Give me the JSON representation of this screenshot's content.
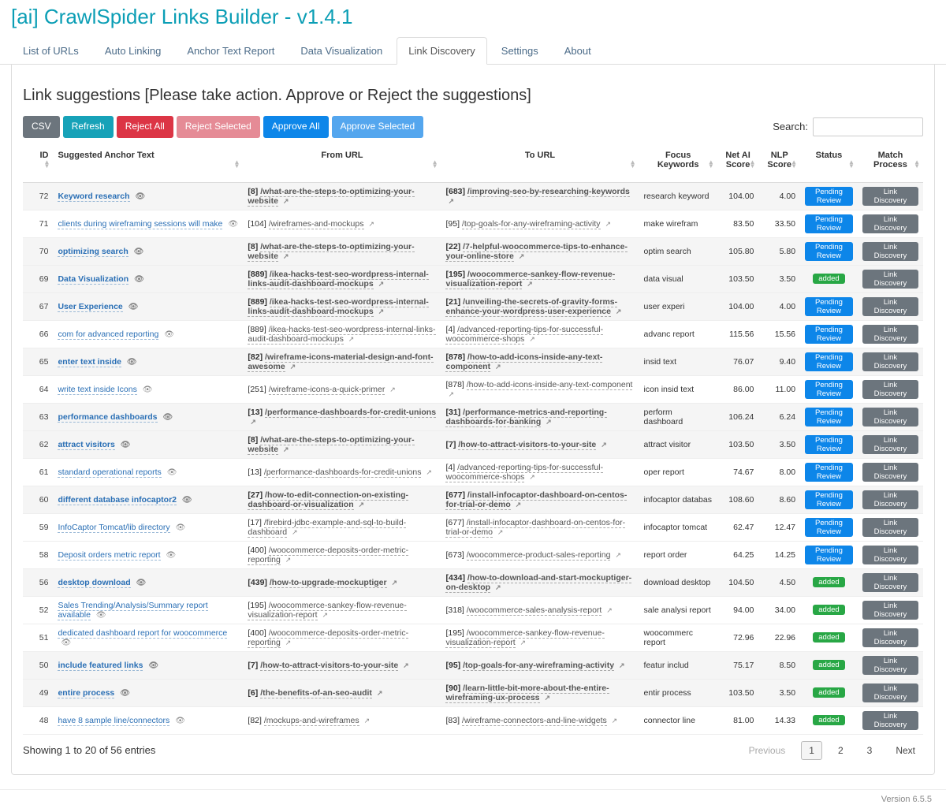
{
  "app_title": "[ai] CrawlSpider Links Builder - v1.4.1",
  "tabs": [
    {
      "label": "List of URLs"
    },
    {
      "label": "Auto Linking"
    },
    {
      "label": "Anchor Text Report"
    },
    {
      "label": "Data Visualization"
    },
    {
      "label": "Link Discovery",
      "active": true
    },
    {
      "label": "Settings"
    },
    {
      "label": "About"
    }
  ],
  "section_heading": "Link suggestions [Please take action. Approve or Reject the suggestions]",
  "toolbar": {
    "csv": "CSV",
    "refresh": "Refresh",
    "reject_all": "Reject All",
    "reject_selected": "Reject Selected",
    "approve_all": "Approve All",
    "approve_selected": "Approve Selected",
    "search_label": "Search:"
  },
  "columns": {
    "id": "ID",
    "anchor": "Suggested Anchor Text",
    "from": "From URL",
    "to": "To URL",
    "focus": "Focus Keywords",
    "net": "Net AI Score",
    "nlp": "NLP Score",
    "status": "Status",
    "match": "Match Process"
  },
  "status_labels": {
    "pending": "Pending Review",
    "added": "added"
  },
  "match_label": "Link Discovery",
  "rows": [
    {
      "id": 72,
      "hl": true,
      "anchor": "Keyword research",
      "from_id": "[8]",
      "from": "/what-are-the-steps-to-optimizing-your-website",
      "to_id": "[683]",
      "to": "/improving-seo-by-researching-keywords",
      "focus": "research keyword",
      "net": "104.00",
      "nlp": "4.00",
      "status": "pending"
    },
    {
      "id": 71,
      "anchor": "clients during wireframing sessions will make",
      "from_id": "[104]",
      "from": "/wireframes-and-mockups",
      "to_id": "[95]",
      "to": "/top-goals-for-any-wireframing-activity",
      "focus": "make wirefram",
      "net": "83.50",
      "nlp": "33.50",
      "status": "pending"
    },
    {
      "id": 70,
      "hl": true,
      "anchor": "optimizing search",
      "from_id": "[8]",
      "from": "/what-are-the-steps-to-optimizing-your-website",
      "to_id": "[22]",
      "to": "/7-helpful-woocommerce-tips-to-enhance-your-online-store",
      "focus": "optim search",
      "net": "105.80",
      "nlp": "5.80",
      "status": "pending"
    },
    {
      "id": 69,
      "hl": true,
      "anchor": "Data Visualization",
      "from_id": "[889]",
      "from": "/ikea-hacks-test-seo-wordpress-internal-links-audit-dashboard-mockups",
      "to_id": "[195]",
      "to": "/woocommerce-sankey-flow-revenue-visualization-report",
      "focus": "data visual",
      "net": "103.50",
      "nlp": "3.50",
      "status": "added"
    },
    {
      "id": 67,
      "hl": true,
      "anchor": "User Experience",
      "from_id": "[889]",
      "from": "/ikea-hacks-test-seo-wordpress-internal-links-audit-dashboard-mockups",
      "to_id": "[21]",
      "to": "/unveiling-the-secrets-of-gravity-forms-enhance-your-wordpress-user-experience",
      "focus": "user experi",
      "net": "104.00",
      "nlp": "4.00",
      "status": "pending"
    },
    {
      "id": 66,
      "anchor": "com for advanced reporting",
      "from_id": "[889]",
      "from": "/ikea-hacks-test-seo-wordpress-internal-links-audit-dashboard-mockups",
      "to_id": "[4]",
      "to": "/advanced-reporting-tips-for-successful-woocommerce-shops",
      "focus": "advanc report",
      "net": "115.56",
      "nlp": "15.56",
      "status": "pending"
    },
    {
      "id": 65,
      "hl": true,
      "anchor": "enter text inside",
      "from_id": "[82]",
      "from": "/wireframe-icons-material-design-and-font-awesome",
      "to_id": "[878]",
      "to": "/how-to-add-icons-inside-any-text-component",
      "focus": "insid text",
      "net": "76.07",
      "nlp": "9.40",
      "status": "pending"
    },
    {
      "id": 64,
      "anchor": "write text inside Icons",
      "from_id": "[251]",
      "from": "/wireframe-icons-a-quick-primer",
      "to_id": "[878]",
      "to": "/how-to-add-icons-inside-any-text-component",
      "focus": "icon insid text",
      "net": "86.00",
      "nlp": "11.00",
      "status": "pending"
    },
    {
      "id": 63,
      "hl": true,
      "anchor": "performance dashboards",
      "from_id": "[13]",
      "from": "/performance-dashboards-for-credit-unions",
      "to_id": "[31]",
      "to": "/performance-metrics-and-reporting-dashboards-for-banking",
      "focus": "perform dashboard",
      "net": "106.24",
      "nlp": "6.24",
      "status": "pending"
    },
    {
      "id": 62,
      "hl": true,
      "anchor": "attract visitors",
      "from_id": "[8]",
      "from": "/what-are-the-steps-to-optimizing-your-website",
      "to_id": "[7]",
      "to": "/how-to-attract-visitors-to-your-site",
      "focus": "attract visitor",
      "net": "103.50",
      "nlp": "3.50",
      "status": "pending"
    },
    {
      "id": 61,
      "anchor": "standard operational reports",
      "from_id": "[13]",
      "from": "/performance-dashboards-for-credit-unions",
      "to_id": "[4]",
      "to": "/advanced-reporting-tips-for-successful-woocommerce-shops",
      "focus": "oper report",
      "net": "74.67",
      "nlp": "8.00",
      "status": "pending"
    },
    {
      "id": 60,
      "hl": true,
      "anchor": "different database infocaptor2",
      "from_id": "[27]",
      "from": "/how-to-edit-connection-on-existing-dashboard-or-visualization",
      "to_id": "[677]",
      "to": "/install-infocaptor-dashboard-on-centos-for-trial-or-demo",
      "focus": "infocaptor databas",
      "net": "108.60",
      "nlp": "8.60",
      "status": "pending"
    },
    {
      "id": 59,
      "anchor": "InfoCaptor Tomcat/lib directory",
      "from_id": "[17]",
      "from": "/firebird-jdbc-example-and-sql-to-build-dashboard",
      "to_id": "[677]",
      "to": "/install-infocaptor-dashboard-on-centos-for-trial-or-demo",
      "focus": "infocaptor tomcat",
      "net": "62.47",
      "nlp": "12.47",
      "status": "pending"
    },
    {
      "id": 58,
      "anchor": "Deposit orders metric report",
      "from_id": "[400]",
      "from": "/woocommerce-deposits-order-metric-reporting",
      "to_id": "[673]",
      "to": "/woocommerce-product-sales-reporting",
      "focus": "report order",
      "net": "64.25",
      "nlp": "14.25",
      "status": "pending"
    },
    {
      "id": 56,
      "hl": true,
      "anchor": "desktop download",
      "from_id": "[439]",
      "from": "/how-to-upgrade-mockuptiger",
      "to_id": "[434]",
      "to": "/how-to-download-and-start-mockuptiger-on-desktop",
      "focus": "download desktop",
      "net": "104.50",
      "nlp": "4.50",
      "status": "added"
    },
    {
      "id": 52,
      "anchor": "Sales Trending/Analysis/Summary report available",
      "from_id": "[195]",
      "from": "/woocommerce-sankey-flow-revenue-visualization-report",
      "to_id": "[318]",
      "to": "/woocommerce-sales-analysis-report",
      "focus": "sale analysi report",
      "net": "94.00",
      "nlp": "34.00",
      "status": "added"
    },
    {
      "id": 51,
      "anchor": "dedicated dashboard report for woocommerce",
      "from_id": "[400]",
      "from": "/woocommerce-deposits-order-metric-reporting",
      "to_id": "[195]",
      "to": "/woocommerce-sankey-flow-revenue-visualization-report",
      "focus": "woocommerc report",
      "net": "72.96",
      "nlp": "22.96",
      "status": "added"
    },
    {
      "id": 50,
      "hl": true,
      "anchor": "include featured links",
      "from_id": "[7]",
      "from": "/how-to-attract-visitors-to-your-site",
      "to_id": "[95]",
      "to": "/top-goals-for-any-wireframing-activity",
      "focus": "featur includ",
      "net": "75.17",
      "nlp": "8.50",
      "status": "added"
    },
    {
      "id": 49,
      "hl": true,
      "anchor": "entire process",
      "from_id": "[6]",
      "from": "/the-benefits-of-an-seo-audit",
      "to_id": "[90]",
      "to": "/learn-little-bit-more-about-the-entire-wireframing-ux-process",
      "focus": "entir process",
      "net": "103.50",
      "nlp": "3.50",
      "status": "added"
    },
    {
      "id": 48,
      "anchor": "have 8 sample line/connectors",
      "from_id": "[82]",
      "from": "/mockups-and-wireframes",
      "to_id": "[83]",
      "to": "/wireframe-connectors-and-line-widgets",
      "focus": "connector line",
      "net": "81.00",
      "nlp": "14.33",
      "status": "added"
    }
  ],
  "footer": {
    "info": "Showing 1 to 20 of 56 entries",
    "previous": "Previous",
    "next": "Next",
    "pages": [
      "1",
      "2",
      "3"
    ],
    "current": 1
  },
  "version": "Version 6.5.5"
}
